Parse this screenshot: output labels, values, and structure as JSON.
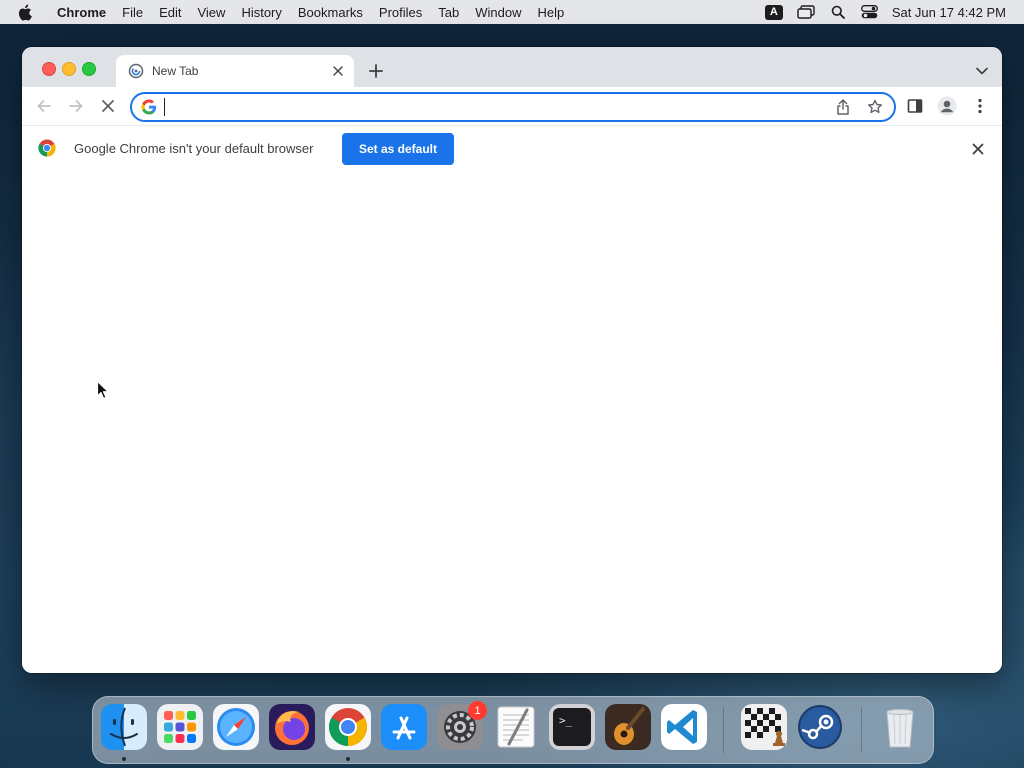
{
  "menubar": {
    "app_name": "Chrome",
    "items": [
      "File",
      "Edit",
      "View",
      "History",
      "Bookmarks",
      "Profiles",
      "Tab",
      "Window",
      "Help"
    ],
    "input_badge": "A",
    "clock": "Sat Jun 17  4:42 PM"
  },
  "browser": {
    "tab": {
      "title": "New Tab"
    },
    "omnibox": {
      "value": "",
      "placeholder": ""
    },
    "infobar": {
      "message": "Google Chrome isn't your default browser",
      "button_label": "Set as default"
    },
    "accent_color": "#1a73e8"
  },
  "dock": {
    "items": [
      {
        "name": "Finder",
        "icon": "finder-icon",
        "running": true
      },
      {
        "name": "Launchpad",
        "icon": "launchpad-icon",
        "running": false
      },
      {
        "name": "Safari",
        "icon": "safari-icon",
        "running": false
      },
      {
        "name": "Firefox",
        "icon": "firefox-icon",
        "running": false
      },
      {
        "name": "Google Chrome",
        "icon": "chrome-icon",
        "running": true
      },
      {
        "name": "App Store",
        "icon": "app-store-icon",
        "running": false
      },
      {
        "name": "System Preferences",
        "icon": "system-preferences-icon",
        "running": false
      },
      {
        "name": "TextEdit",
        "icon": "textedit-icon",
        "running": false
      },
      {
        "name": "Terminal",
        "icon": "terminal-icon",
        "running": false
      },
      {
        "name": "GarageBand",
        "icon": "garageband-icon",
        "running": false
      },
      {
        "name": "Visual Studio Code",
        "icon": "vscode-icon",
        "running": false
      },
      {
        "name": "Chess",
        "icon": "chess-icon",
        "running": false
      },
      {
        "name": "Steam",
        "icon": "steam-icon",
        "running": false
      },
      {
        "name": "Trash",
        "icon": "trash-icon",
        "running": false
      }
    ],
    "notification_badge": "1",
    "terminal_prompt": ">_"
  }
}
